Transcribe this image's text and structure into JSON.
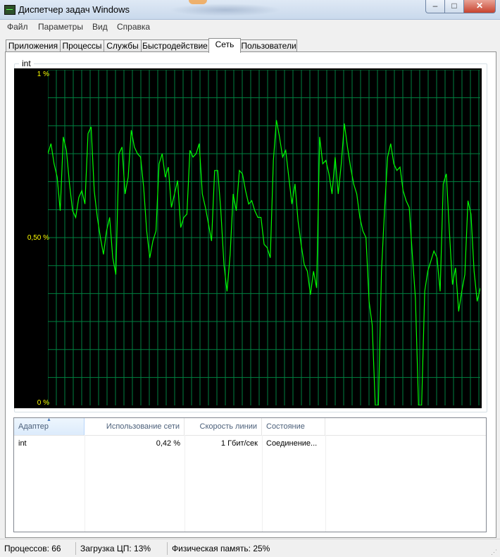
{
  "window": {
    "title": "Диспетчер задач Windows"
  },
  "menu": [
    "Файл",
    "Параметры",
    "Вид",
    "Справка"
  ],
  "tabs": {
    "active_index": 4,
    "labels": [
      "Приложения",
      "Процессы",
      "Службы",
      "Быстродействие",
      "Сеть",
      "Пользователи"
    ]
  },
  "network": {
    "adapter_group_title": "int",
    "axis_labels": {
      "top": "1 %",
      "middle": "0,50 %",
      "bottom": "0 %"
    }
  },
  "colors": {
    "graph_background": "#000000",
    "grid": "#008040",
    "line": "#00ff00",
    "axis_text": "#ffff00"
  },
  "chart_data": {
    "type": "line",
    "title": "",
    "xlabel": "",
    "ylabel": "",
    "ylim": [
      0,
      1
    ],
    "y_unit": "%",
    "grid": true,
    "series": [
      {
        "values": [
          0.75,
          0.78,
          0.72,
          0.68,
          0.58,
          0.8,
          0.76,
          0.66,
          0.58,
          0.56,
          0.62,
          0.64,
          0.6,
          0.81,
          0.83,
          0.64,
          0.56,
          0.5,
          0.45,
          0.52,
          0.56,
          0.44,
          0.39,
          0.75,
          0.77,
          0.63,
          0.68,
          0.82,
          0.77,
          0.75,
          0.74,
          0.65,
          0.52,
          0.44,
          0.49,
          0.52,
          0.72,
          0.75,
          0.68,
          0.71,
          0.59,
          0.63,
          0.67,
          0.53,
          0.56,
          0.57,
          0.76,
          0.74,
          0.75,
          0.78,
          0.63,
          0.59,
          0.54,
          0.49,
          0.7,
          0.7,
          0.58,
          0.42,
          0.34,
          0.45,
          0.63,
          0.58,
          0.7,
          0.69,
          0.64,
          0.6,
          0.61,
          0.58,
          0.56,
          0.56,
          0.48,
          0.47,
          0.44,
          0.73,
          0.85,
          0.8,
          0.74,
          0.76,
          0.68,
          0.6,
          0.66,
          0.55,
          0.48,
          0.42,
          0.4,
          0.33,
          0.4,
          0.35,
          0.8,
          0.72,
          0.73,
          0.69,
          0.63,
          0.74,
          0.63,
          0.72,
          0.84,
          0.77,
          0.71,
          0.66,
          0.63,
          0.56,
          0.52,
          0.5,
          0.31,
          0.24,
          0.0,
          0.0,
          0.4,
          0.58,
          0.74,
          0.78,
          0.72,
          0.7,
          0.71,
          0.64,
          0.61,
          0.59,
          0.45,
          0.32,
          0.0,
          0.0,
          0.34,
          0.4,
          0.43,
          0.46,
          0.44,
          0.34,
          0.66,
          0.69,
          0.52,
          0.36,
          0.41,
          0.28,
          0.34,
          0.39,
          0.61,
          0.57,
          0.4,
          0.31,
          0.35
        ]
      }
    ]
  },
  "table": {
    "columns": [
      "Адаптер",
      "Использование сети",
      "Скорость линии",
      "Состояние"
    ],
    "sort_column": "Адаптер",
    "rows": [
      {
        "adapter": "int",
        "usage": "0,42 %",
        "speed": "1 Гбит/сек",
        "state": "Соединение..."
      }
    ]
  },
  "status": {
    "processes": "Процессов: 66",
    "cpu": "Загрузка ЦП: 13%",
    "memory": "Физическая память: 25%"
  }
}
